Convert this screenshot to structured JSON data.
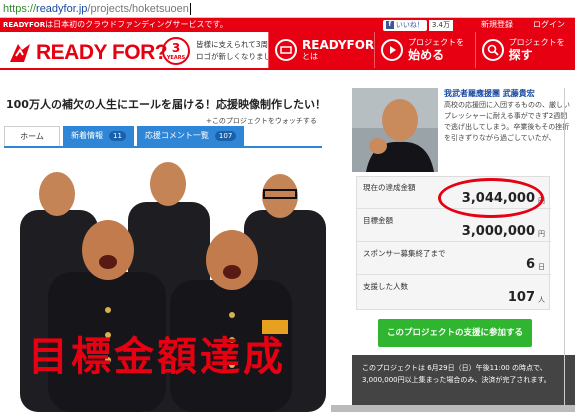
{
  "browser": {
    "url_scheme": "https://",
    "url_host": "readyfor.jp",
    "url_path": "/projects/hoketsuoen"
  },
  "topbar": {
    "brand": "READYFOR",
    "tagline": "は日本初のクラウドファンディングサービスです。",
    "like_label": "いいね！",
    "like_count": "3.4万",
    "register": "新規登録",
    "login": "ログイン"
  },
  "header": {
    "logo_text": "READY FOR?",
    "anniv_number": "3",
    "anniv_label": "YEARS",
    "tagline_line1": "皆様に支えられて3周年。",
    "tagline_line2": "ロゴが新しくなりました！",
    "nav": [
      {
        "small": "",
        "big": "READYFOR",
        "small2": "とは",
        "icon": "ticket-icon"
      },
      {
        "small": "プロジェクトを",
        "big": "始める",
        "small2": "",
        "icon": "play-icon"
      },
      {
        "small": "プロジェクトを",
        "big": "探す",
        "small2": "",
        "icon": "search-icon"
      }
    ]
  },
  "project": {
    "title": "100万人の補欠の人生にエールを届ける！応援映像制作したい！",
    "watch_label": "このプロジェクトをウォッチする",
    "tabs": [
      {
        "label": "ホーム",
        "count": ""
      },
      {
        "label": "新着情報",
        "count": "11"
      },
      {
        "label": "応援コメント一覧",
        "count": "107"
      }
    ],
    "overlay_text": "目標金額達成"
  },
  "proposer": {
    "name": "我武者羅應援團 武藤貴宏",
    "description": "高校の応援団に入団するものの、厳しいプレッシャーに耐える事ができず2週間で逃げ出してしまう。卒業後もその挫折を引きずりながら過ごしていたが、"
  },
  "stats": [
    {
      "label": "現在の達成金額",
      "value": "3,044,000",
      "unit": "円"
    },
    {
      "label": "目標金額",
      "value": "3,000,000",
      "unit": "円"
    },
    {
      "label": "スポンサー募集終了まで",
      "value": "6",
      "unit": "日"
    },
    {
      "label": "支援した人数",
      "value": "107",
      "unit": "人"
    }
  ],
  "support_button": "このプロジェクトの支援に参加する",
  "notice": {
    "line1": "このプロジェクトは 6月29日（日）午後11:00 の時点で、",
    "line2": "3,000,000円以上集まった場合のみ、決済が完了されます。"
  },
  "colors": {
    "brand_red": "#e60012",
    "tab_blue": "#2f86d6",
    "support_green": "#2fb52f"
  }
}
